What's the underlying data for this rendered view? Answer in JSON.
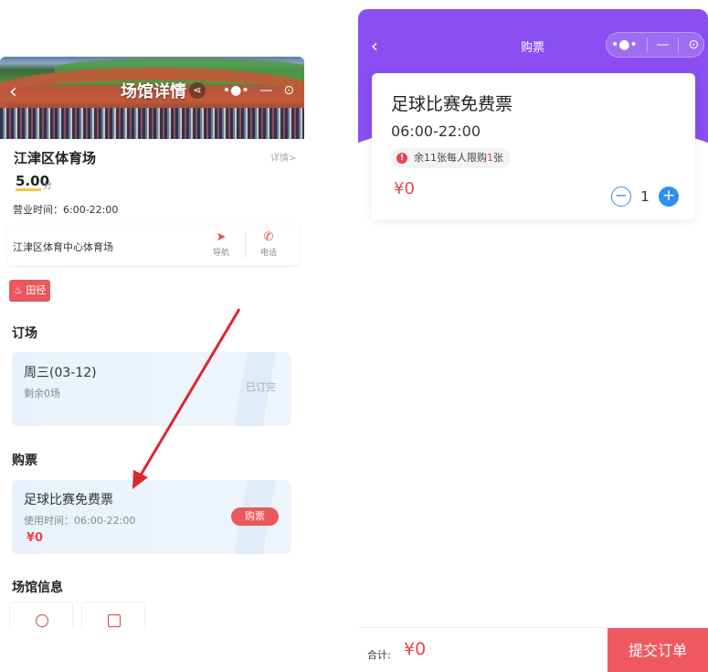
{
  "left": {
    "header_title": "场馆详情",
    "share_icon": "share-icon",
    "capsule": {
      "more": "•●•",
      "minimize": "—",
      "close": "⊙"
    },
    "venue_name": "江津区体育场",
    "detail_link": "详情>",
    "score": "5.00",
    "score_unit": "分",
    "hours": "营业时间：6:00-22:00",
    "address": "江津区体育中心体育场",
    "nav_label": "导航",
    "call_label": "电话",
    "tag": "田径",
    "booking_section": "订场",
    "booking": {
      "date": "周三(03-12)",
      "remain": "剩余0场",
      "status": "已订完"
    },
    "ticket_section": "购票",
    "ticket": {
      "name": "足球比赛免费票",
      "time": "使用时间：06:00-22:00",
      "price": "¥0",
      "buy": "购票"
    },
    "info_section": "场馆信息"
  },
  "right": {
    "title": "购票",
    "card": {
      "name": "足球比赛免费票",
      "time": "06:00-22:00",
      "notice_prefix": "余11张每人限购",
      "notice_limit": "1",
      "notice_suffix": "张",
      "price": "¥0",
      "quantity": "1"
    },
    "footer": {
      "total_label": "合计:",
      "total_value": "¥0",
      "submit": "提交订单"
    }
  },
  "colors": {
    "accent_red": "#e6474c",
    "purple": "#8a4ef2",
    "blue": "#2f8ff0"
  }
}
